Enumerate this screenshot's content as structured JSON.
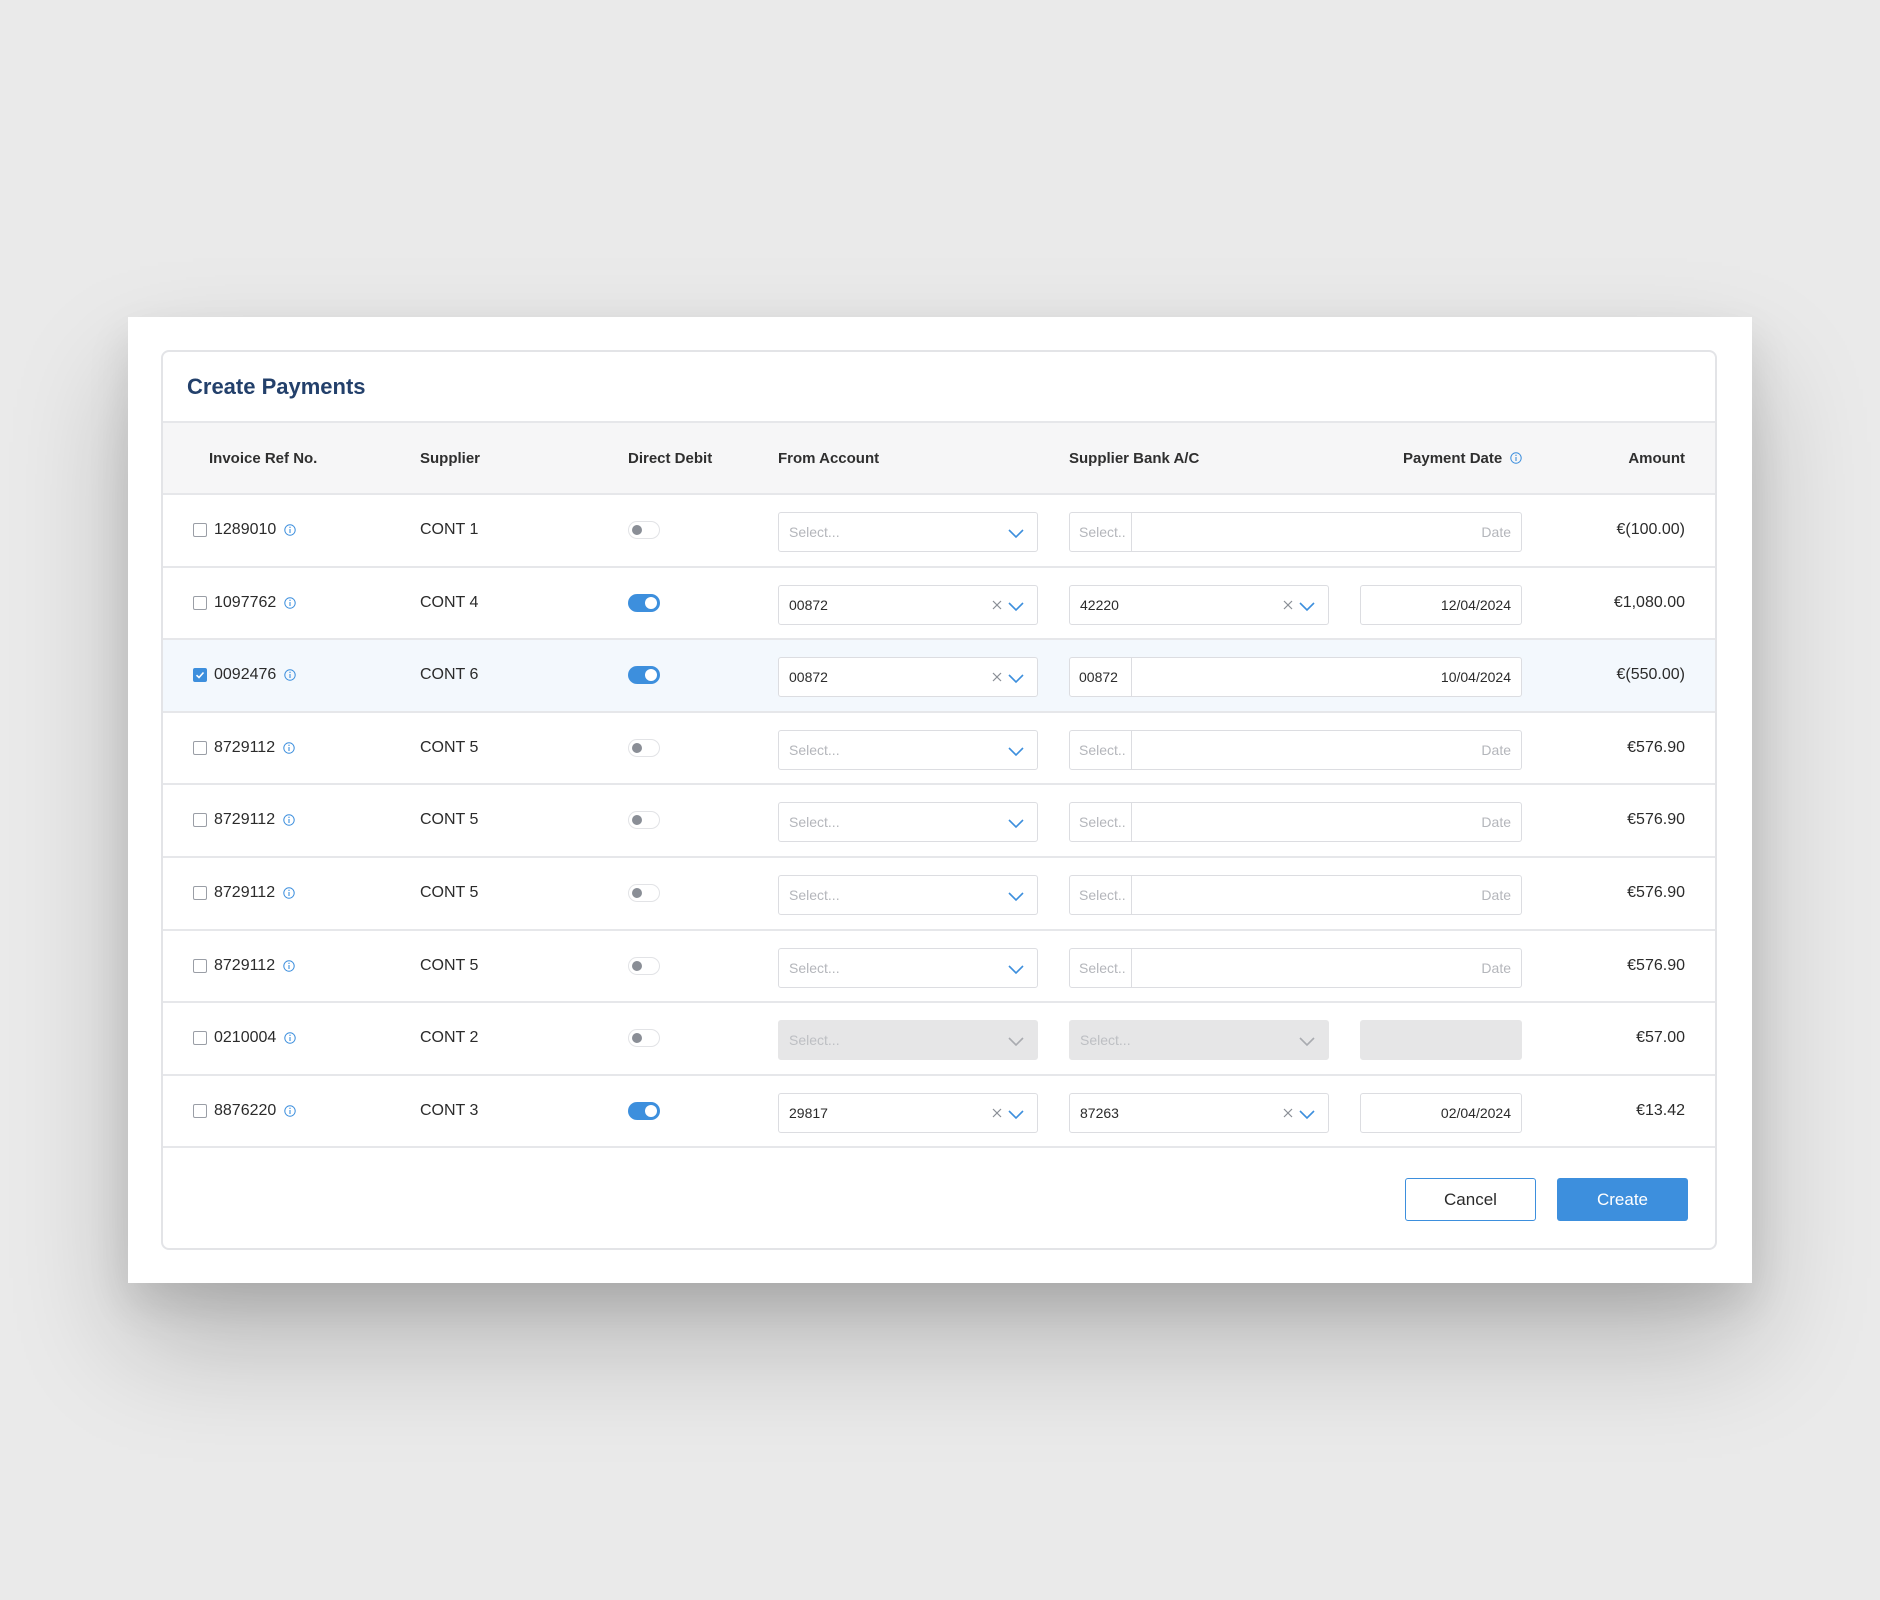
{
  "dialog": {
    "title": "Create Payments"
  },
  "columns": {
    "invoice_ref": "Invoice Ref No.",
    "supplier": "Supplier",
    "direct_debit": "Direct Debit",
    "from_account": "From Account",
    "supplier_bank": "Supplier Bank A/C",
    "payment_date": "Payment Date",
    "amount": "Amount"
  },
  "placeholders": {
    "select": "Select...",
    "select_short": "Select..",
    "date": "Date"
  },
  "rows": [
    {
      "ref": "1289010",
      "supplier": "CONT 1",
      "checked": false,
      "direct_debit": false,
      "mode": "combo",
      "from_account": "",
      "bank": "",
      "date": "",
      "amount": "€(100.00)"
    },
    {
      "ref": "1097762",
      "supplier": "CONT 4",
      "checked": false,
      "direct_debit": true,
      "mode": "select",
      "from_account": "00872",
      "bank": "42220",
      "date": "12/04/2024",
      "amount": "€1,080.00"
    },
    {
      "ref": "0092476",
      "supplier": "CONT 6",
      "checked": true,
      "direct_debit": true,
      "mode": "combo",
      "from_account": "00872",
      "bank": "00872",
      "date": "10/04/2024",
      "amount": "€(550.00)"
    },
    {
      "ref": "8729112",
      "supplier": "CONT 5",
      "checked": false,
      "direct_debit": false,
      "mode": "combo",
      "from_account": "",
      "bank": "",
      "date": "",
      "amount": "€576.90"
    },
    {
      "ref": "8729112",
      "supplier": "CONT 5",
      "checked": false,
      "direct_debit": false,
      "mode": "combo",
      "from_account": "",
      "bank": "",
      "date": "",
      "amount": "€576.90"
    },
    {
      "ref": "8729112",
      "supplier": "CONT 5",
      "checked": false,
      "direct_debit": false,
      "mode": "combo",
      "from_account": "",
      "bank": "",
      "date": "",
      "amount": "€576.90"
    },
    {
      "ref": "8729112",
      "supplier": "CONT 5",
      "checked": false,
      "direct_debit": false,
      "mode": "combo",
      "from_account": "",
      "bank": "",
      "date": "",
      "amount": "€576.90"
    },
    {
      "ref": "0210004",
      "supplier": "CONT 2",
      "checked": false,
      "direct_debit": false,
      "mode": "disabled",
      "from_account": "",
      "bank": "",
      "date": "",
      "amount": "€57.00"
    },
    {
      "ref": "8876220",
      "supplier": "CONT 3",
      "checked": false,
      "direct_debit": true,
      "mode": "select",
      "from_account": "29817",
      "bank": "87263",
      "date": "02/04/2024",
      "amount": "€13.42"
    }
  ],
  "actions": {
    "cancel": "Cancel",
    "create": "Create"
  },
  "colors": {
    "accent": "#3d8fdd",
    "title": "#23406b",
    "selected_row": "#f3f8fd",
    "disabled_field": "#e6e6e7"
  },
  "icons": {
    "info": "info-circle-icon",
    "clear": "close-icon",
    "dropdown": "chevron-down-icon",
    "check": "check-icon"
  }
}
